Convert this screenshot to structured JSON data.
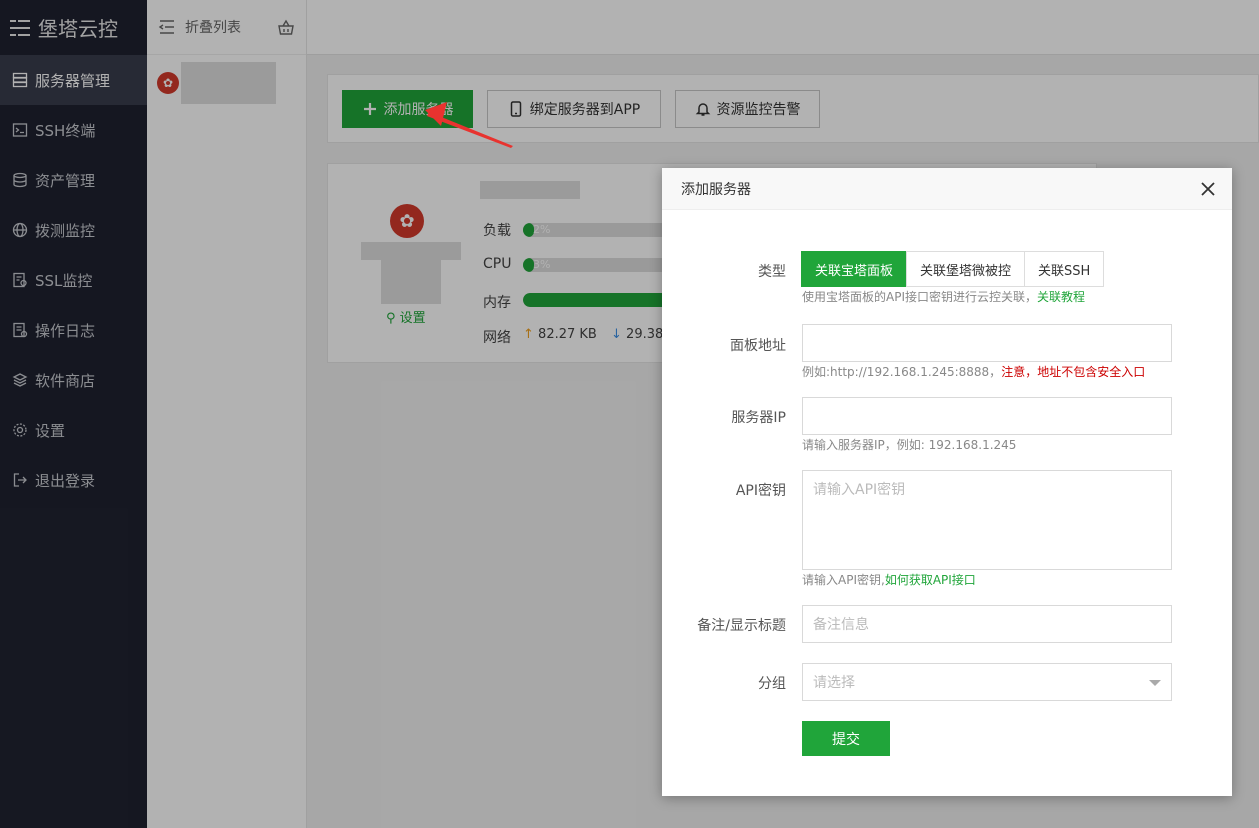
{
  "sidebar": {
    "brand": "堡塔云控",
    "items": [
      {
        "label": "服务器管理",
        "icon": "server-icon",
        "active": true
      },
      {
        "label": "SSH终端",
        "icon": "terminal-icon"
      },
      {
        "label": "资产管理",
        "icon": "database-icon"
      },
      {
        "label": "拨测监控",
        "icon": "globe-icon"
      },
      {
        "label": "SSL监控",
        "icon": "certificate-icon"
      },
      {
        "label": "操作日志",
        "icon": "log-icon"
      },
      {
        "label": "软件商店",
        "icon": "layers-icon"
      },
      {
        "label": "设置",
        "icon": "gear-icon"
      },
      {
        "label": "退出登录",
        "icon": "logout-icon"
      }
    ]
  },
  "list_panel": {
    "collapse_label": "折叠列表"
  },
  "toolbar": {
    "add_server": "添加服务器",
    "bind_app": "绑定服务器到APP",
    "alarm": "资源监控告警"
  },
  "server_card": {
    "settings_label": "设置",
    "load_label": "负载",
    "load_value": "2%",
    "load_percent": 2,
    "cpu_label": "CPU",
    "cpu_value": "3%",
    "cpu_percent": 3,
    "mem_label": "内存",
    "net_label": "网络",
    "net_up": "82.27 KB",
    "net_down": "29.38"
  },
  "modal": {
    "title": "添加服务器",
    "type_label": "类型",
    "type_tabs": [
      "关联宝塔面板",
      "关联堡塔微被控",
      "关联SSH"
    ],
    "type_hint": "使用宝塔面板的API接口密钥进行云控关联，",
    "type_hint_link": "关联教程",
    "panel_addr_label": "面板地址",
    "panel_addr_hint": "例如:http://192.168.1.245:8888，",
    "panel_addr_warn": "注意，地址不包含安全入口",
    "server_ip_label": "服务器IP",
    "server_ip_hint": "请输入服务器IP，例如: 192.168.1.245",
    "api_key_label": "API密钥",
    "api_key_placeholder": "请输入API密钥",
    "api_key_hint": "请输入API密钥,",
    "api_key_link": "如何获取API接口",
    "remark_label": "备注/显示标题",
    "remark_placeholder": "备注信息",
    "group_label": "分组",
    "group_placeholder": "请选择",
    "submit": "提交"
  },
  "colors": {
    "accent": "#20a53a",
    "sidebar_bg": "#1f2230",
    "warn": "#cc0000",
    "arrow": "#e8332f"
  }
}
